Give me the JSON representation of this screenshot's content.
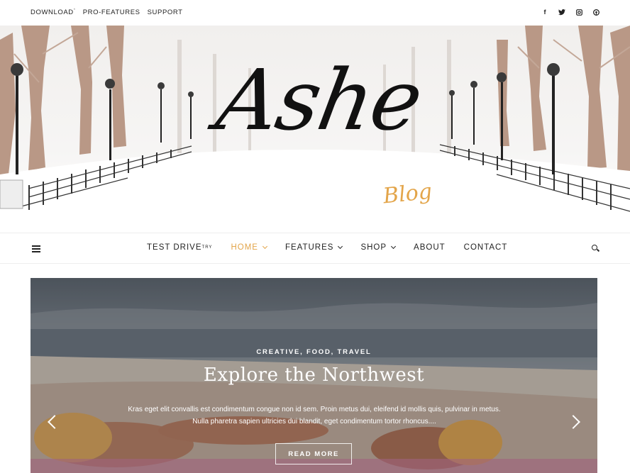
{
  "topbar": {
    "links": [
      {
        "label": "DOWNLOAD",
        "sup": "*"
      },
      {
        "label": "PRO-FEATURES",
        "sup": ""
      },
      {
        "label": "SUPPORT",
        "sup": ""
      }
    ],
    "social_icons": [
      "facebook-icon",
      "twitter-icon",
      "instagram-icon",
      "pinterest-icon"
    ]
  },
  "header": {
    "title": "Ashe",
    "subtitle": "Blog"
  },
  "nav": {
    "items": [
      {
        "label": "TEST DRIVE",
        "sup": "TRY",
        "dropdown": false,
        "active": false
      },
      {
        "label": "HOME",
        "sup": "",
        "dropdown": true,
        "active": true
      },
      {
        "label": "FEATURES",
        "sup": "",
        "dropdown": true,
        "active": false
      },
      {
        "label": "SHOP",
        "sup": "",
        "dropdown": true,
        "active": false
      },
      {
        "label": "ABOUT",
        "sup": "",
        "dropdown": false,
        "active": false
      },
      {
        "label": "CONTACT",
        "sup": "",
        "dropdown": false,
        "active": false
      }
    ]
  },
  "slider": {
    "categories": "CREATIVE, FOOD, TRAVEL",
    "title": "Explore the Northwest",
    "excerpt": "Kras eget elit convallis est condimentum congue non id sem. Proin metus dui, eleifend id mollis quis, pulvinar in metus. Nulla pharetra sapien ultricies dui blandit, eget condimentum tortor rhoncus....",
    "read_more": "READ MORE"
  },
  "colors": {
    "accent": "#e3a54a",
    "text": "#222222"
  }
}
